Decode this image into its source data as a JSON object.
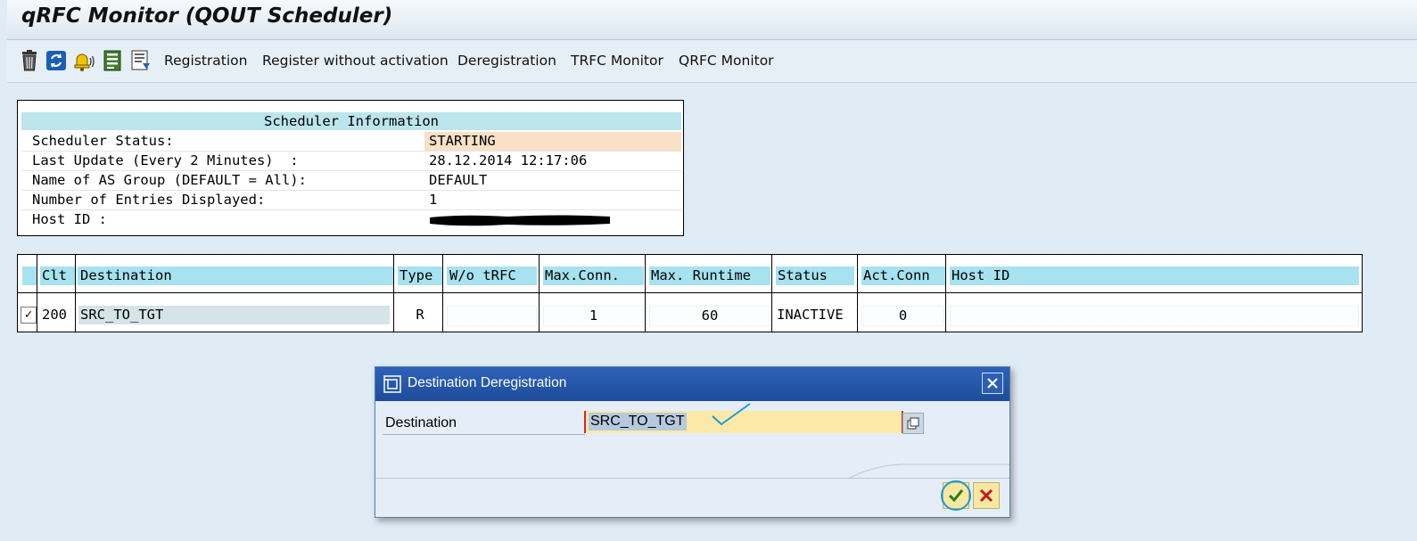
{
  "window": {
    "title": "qRFC Monitor (QOUT Scheduler)"
  },
  "toolbar": {
    "icons": [
      "delete-icon",
      "refresh-icon",
      "alert-bell-icon",
      "detail-icon",
      "display-list-icon"
    ],
    "buttons": [
      "Registration",
      "Register without activation",
      "Deregistration",
      "TRFC Monitor",
      "QRFC Monitor"
    ]
  },
  "scheduler_info": {
    "header": "Scheduler Information",
    "rows": [
      {
        "label": "Scheduler Status:",
        "value": "STARTING"
      },
      {
        "label": "Last Update (Every 2 Minutes)  :",
        "value": "28.12.2014 12:17:06"
      },
      {
        "label": "Name of AS Group (DEFAULT = All):",
        "value": "DEFAULT"
      },
      {
        "label": "Number of Entries Displayed:",
        "value": "1"
      },
      {
        "label": "Host ID :",
        "value": ""
      }
    ],
    "status_color": "#f8e1c6"
  },
  "table": {
    "columns": [
      "Clt",
      "Destination",
      "Type",
      "W/o tRFC",
      "Max.Conn.",
      "Max. Runtime",
      "Status",
      "Act.Conn",
      "Host ID"
    ],
    "rows": [
      {
        "checked": "✓",
        "clt": "200",
        "destination": "SRC_TO_TGT",
        "type": "R",
        "wo_trfc": "",
        "max_conn": "1",
        "max_runtime": "60",
        "status": "INACTIVE",
        "act_conn": "0",
        "host_id": ""
      }
    ]
  },
  "dialog": {
    "title": "Destination Deregistration",
    "field_label": "Destination",
    "field_value": "SRC_TO_TGT",
    "ok_icon": "checkmark-icon",
    "cancel_icon": "cancel-x-icon"
  }
}
